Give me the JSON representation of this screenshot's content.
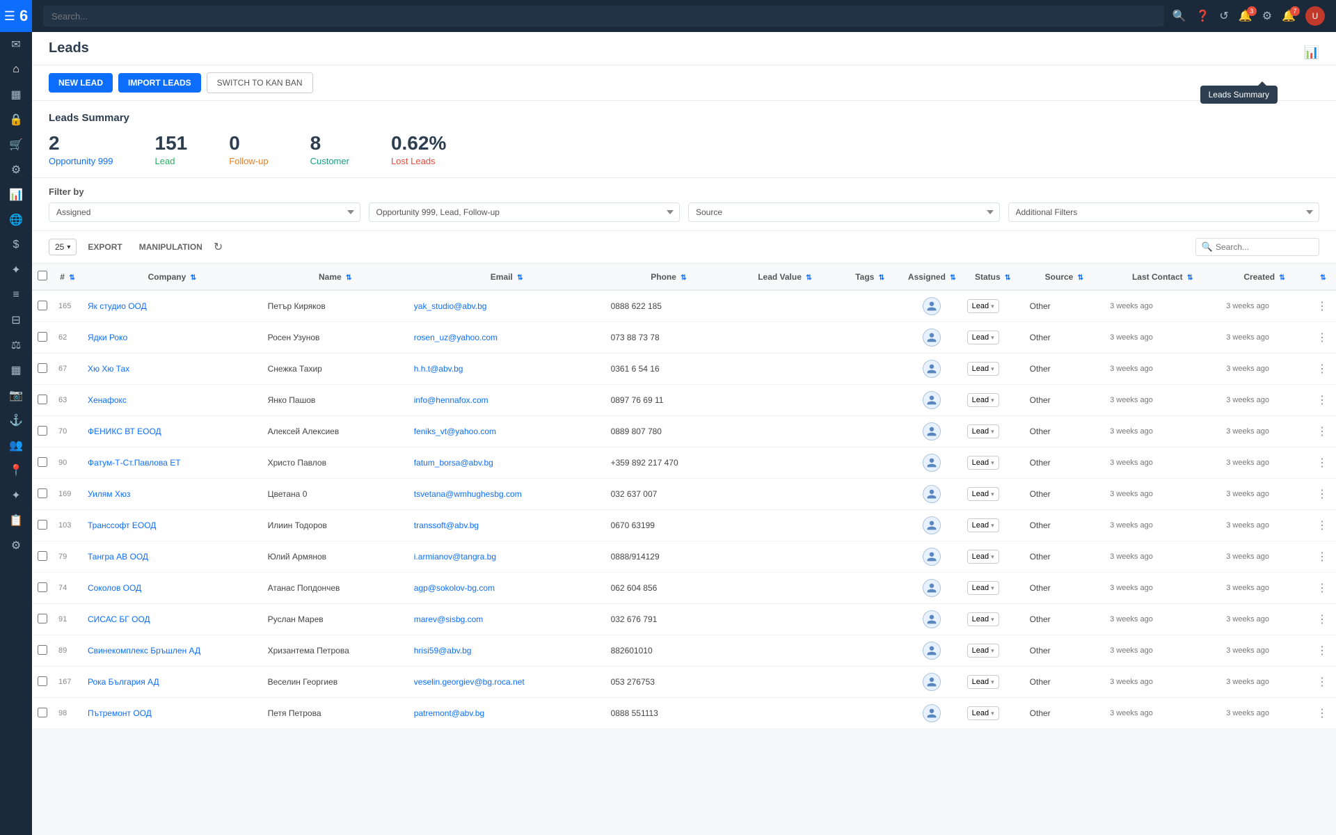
{
  "app": {
    "logo": "6",
    "title": "Leads"
  },
  "topbar": {
    "search_placeholder": "Search...",
    "notification_count": "3",
    "alert_count": "7"
  },
  "toolbar": {
    "new_lead": "NEW LEAD",
    "import_leads": "IMPORT LEADS",
    "switch_kanban": "SWITCH TO KAN BAN"
  },
  "summary": {
    "title": "Leads Summary",
    "cards": [
      {
        "value": "2",
        "label": "Opportunity 999",
        "color": "blue"
      },
      {
        "value": "151",
        "label": "Lead",
        "color": "green"
      },
      {
        "value": "0",
        "label": "Follow-up",
        "color": "orange"
      },
      {
        "value": "8",
        "label": "Customer",
        "color": "teal"
      },
      {
        "value": "0.62%",
        "label": "Lost Leads",
        "color": "red"
      }
    ]
  },
  "filters": {
    "title": "Filter by",
    "assigned_label": "Assigned",
    "status_label": "Opportunity 999, Lead, Follow-up",
    "source_label": "Source",
    "additional_label": "Additional Filters"
  },
  "table_toolbar": {
    "count": "25",
    "export_label": "EXPORT",
    "manipulation_label": "MANIPULATION",
    "search_placeholder": "Search..."
  },
  "table": {
    "columns": [
      "#",
      "Company",
      "Name",
      "Email",
      "Phone",
      "Lead Value",
      "Tags",
      "Assigned",
      "Status",
      "Source",
      "Last Contact",
      "Created",
      ""
    ],
    "rows": [
      {
        "id": "165",
        "company": "Як студио ООД",
        "name": "Петър Киряков",
        "email": "yak_studio@abv.bg",
        "phone": "0888 622 185",
        "lead_value": "",
        "tags": "",
        "assigned": "",
        "status": "Lead",
        "source": "Other",
        "last_contact": "3 weeks ago",
        "created": "3 weeks ago"
      },
      {
        "id": "62",
        "company": "Ядки Роко",
        "name": "Росен Узунов",
        "email": "rosen_uz@yahoo.com",
        "phone": "073 88 73 78",
        "lead_value": "",
        "tags": "",
        "assigned": "",
        "status": "Lead",
        "source": "Other",
        "last_contact": "3 weeks ago",
        "created": "3 weeks ago"
      },
      {
        "id": "67",
        "company": "Хю Хю Тах",
        "name": "Снежка Тахир",
        "email": "h.h.t@abv.bg",
        "phone": "0361 6 54 16",
        "lead_value": "",
        "tags": "",
        "assigned": "",
        "status": "Lead",
        "source": "Other",
        "last_contact": "3 weeks ago",
        "created": "3 weeks ago"
      },
      {
        "id": "63",
        "company": "Хенафокс",
        "name": "Янко Пашов",
        "email": "info@hennafox.com",
        "phone": "0897 76 69 11",
        "lead_value": "",
        "tags": "",
        "assigned": "",
        "status": "Lead",
        "source": "Other",
        "last_contact": "3 weeks ago",
        "created": "3 weeks ago"
      },
      {
        "id": "70",
        "company": "ФЕНИКС ВТ ЕООД",
        "name": "Алексей Алексиев",
        "email": "feniks_vt@yahoo.com",
        "phone": "0889 807 780",
        "lead_value": "",
        "tags": "",
        "assigned": "",
        "status": "Lead",
        "source": "Other",
        "last_contact": "3 weeks ago",
        "created": "3 weeks ago"
      },
      {
        "id": "90",
        "company": "Фатум-Т-Ст.Павлова ЕТ",
        "name": "Христо Павлов",
        "email": "fatum_borsa@abv.bg",
        "phone": "+359 892 217 470",
        "lead_value": "",
        "tags": "",
        "assigned": "",
        "status": "Lead",
        "source": "Other",
        "last_contact": "3 weeks ago",
        "created": "3 weeks ago"
      },
      {
        "id": "169",
        "company": "Уилям Хюз",
        "name": "Цветана 0",
        "email": "tsvetana@wmhughesbg.com",
        "phone": "032 637 007",
        "lead_value": "",
        "tags": "",
        "assigned": "",
        "status": "Lead",
        "source": "Other",
        "last_contact": "3 weeks ago",
        "created": "3 weeks ago"
      },
      {
        "id": "103",
        "company": "Транссофт ЕООД",
        "name": "Илиин Тодоров",
        "email": "transsoft@abv.bg",
        "phone": "0670 63199",
        "lead_value": "",
        "tags": "",
        "assigned": "",
        "status": "Lead",
        "source": "Other",
        "last_contact": "3 weeks ago",
        "created": "3 weeks ago"
      },
      {
        "id": "79",
        "company": "Тангра АВ ООД",
        "name": "Юлий Армянов",
        "email": "i.armianov@tangra.bg",
        "phone": "0888/914129",
        "lead_value": "",
        "tags": "",
        "assigned": "",
        "status": "Lead",
        "source": "Other",
        "last_contact": "3 weeks ago",
        "created": "3 weeks ago"
      },
      {
        "id": "74",
        "company": "Соколов ООД",
        "name": "Атанас Попдончев",
        "email": "agp@sokolov-bg.com",
        "phone": "062 604 856",
        "lead_value": "",
        "tags": "",
        "assigned": "",
        "status": "Lead",
        "source": "Other",
        "last_contact": "3 weeks ago",
        "created": "3 weeks ago"
      },
      {
        "id": "91",
        "company": "СИСАС БГ ООД",
        "name": "Руслан Марев",
        "email": "marev@sisbg.com",
        "phone": "032 676 791",
        "lead_value": "",
        "tags": "",
        "assigned": "",
        "status": "Lead",
        "source": "Other",
        "last_contact": "3 weeks ago",
        "created": "3 weeks ago"
      },
      {
        "id": "89",
        "company": "Свинекомплекс Бръшлен АД",
        "name": "Хризантема Петрова",
        "email": "hrisi59@abv.bg",
        "phone": "882601010",
        "lead_value": "",
        "tags": "",
        "assigned": "",
        "status": "Lead",
        "source": "Other",
        "last_contact": "3 weeks ago",
        "created": "3 weeks ago"
      },
      {
        "id": "167",
        "company": "Рока България АД",
        "name": "Веселин Георгиев",
        "email": "veselin.georgiev@bg.roca.net",
        "phone": "053 276753",
        "lead_value": "",
        "tags": "",
        "assigned": "",
        "status": "Lead",
        "source": "Other",
        "last_contact": "3 weeks ago",
        "created": "3 weeks ago"
      },
      {
        "id": "98",
        "company": "Пътремонт ООД",
        "name": "Петя Петрова",
        "email": "patremont@abv.bg",
        "phone": "0888 551113",
        "lead_value": "",
        "tags": "",
        "assigned": "",
        "status": "Lead",
        "source": "Other",
        "last_contact": "3 weeks ago",
        "created": "3 weeks ago"
      }
    ]
  },
  "tooltip": {
    "text": "Leads Summary"
  },
  "sidebar_icons": [
    "menu-icon",
    "email-icon",
    "home-icon",
    "calendar-icon",
    "lock-icon",
    "cart-icon",
    "settings-icon",
    "chart-icon",
    "globe-icon",
    "dollar-icon",
    "star-icon",
    "list-icon",
    "filter-icon",
    "balance-icon",
    "bar-chart-icon",
    "camera-icon",
    "anchor-icon",
    "people-icon",
    "location-icon",
    "network-icon",
    "report-icon",
    "gear-icon"
  ]
}
